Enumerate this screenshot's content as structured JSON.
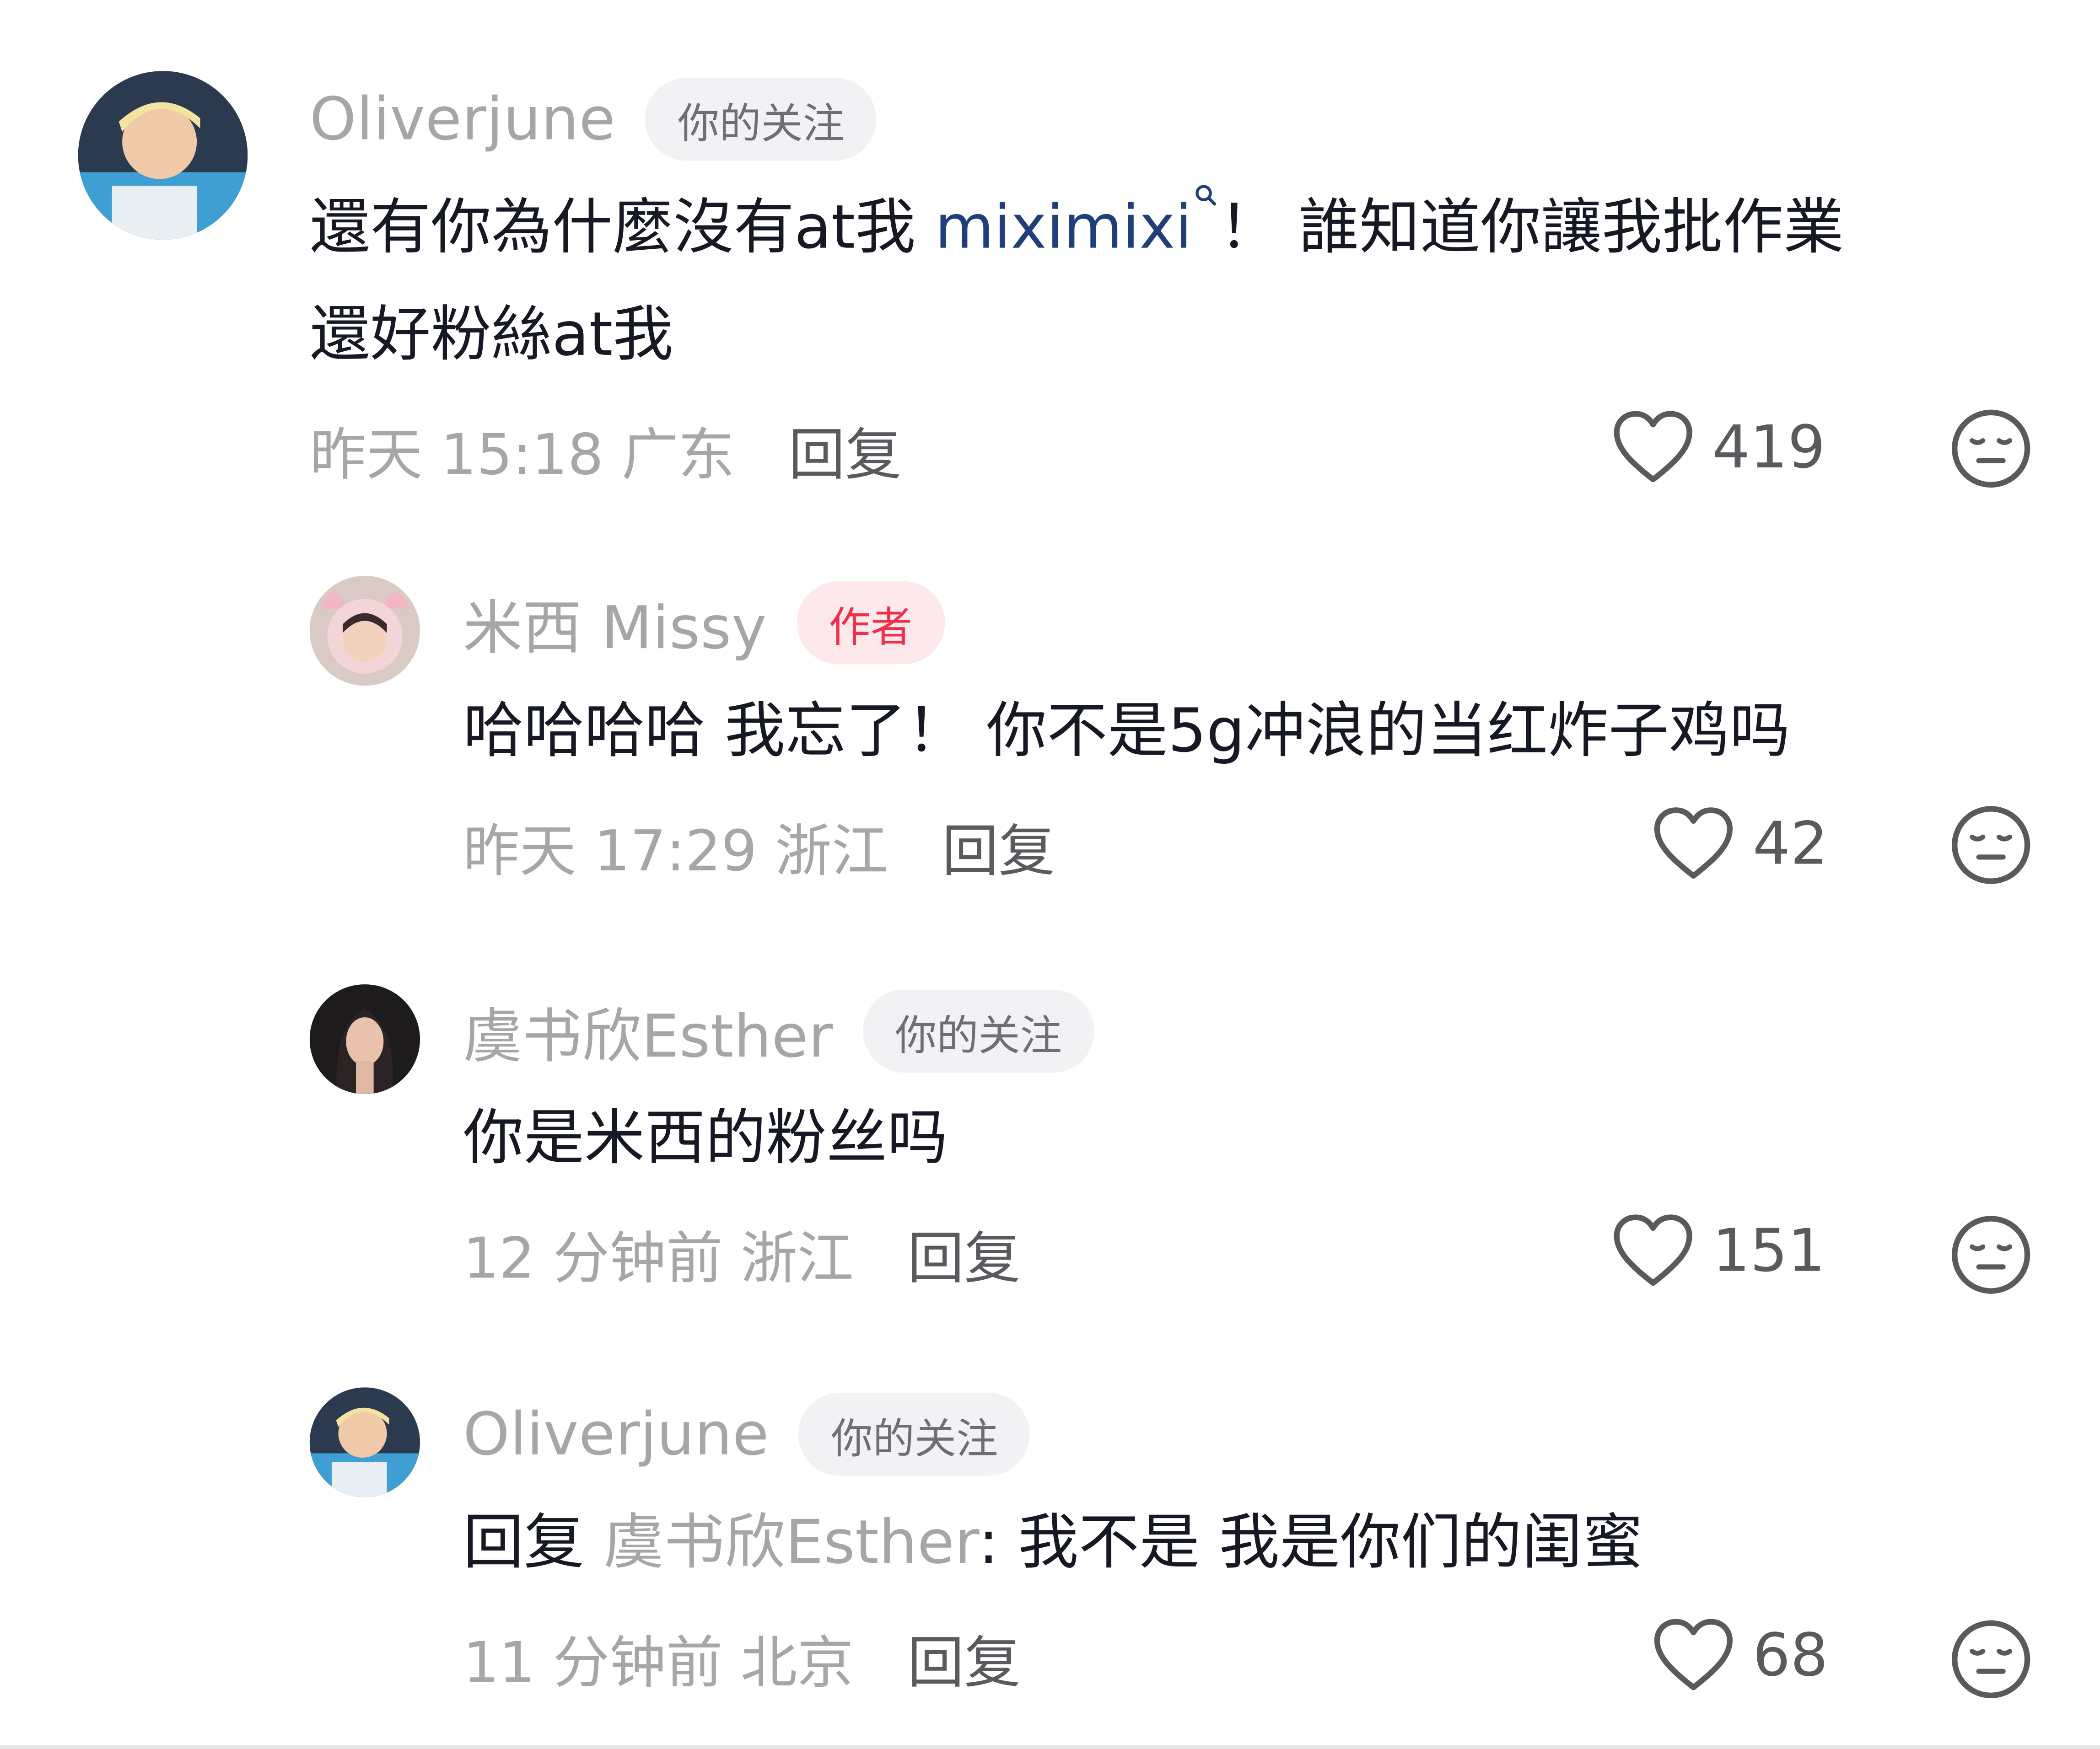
{
  "comments": [
    {
      "username": "Oliverjune",
      "badge": "你的关注",
      "text_line1_pre": "還有你為什麼沒有at我 ",
      "mention": "miximixi",
      "text_line1_post": "！ 誰知道你讓我批作業",
      "text_line2": "還好粉絲at我",
      "time": "昨天 15:18 广东",
      "reply": "回复",
      "likes": "419"
    },
    {
      "username": "米西 Missy",
      "badge": "作者",
      "text": "哈哈哈哈 我忘了！ 你不是5g冲浪的当红炸子鸡吗",
      "time": "昨天 17:29 浙江",
      "reply": "回复",
      "likes": "42"
    },
    {
      "username": "虞书欣Esther",
      "badge": "你的关注",
      "text": "你是米西的粉丝吗",
      "time": "12 分钟前 浙江",
      "reply": "回复",
      "likes": "151"
    },
    {
      "username": "Oliverjune",
      "badge": "你的关注",
      "reply_prefix": "回复 ",
      "reply_to": "虞书欣Esther",
      "text_after": ": 我不是 我是你们的闺蜜",
      "time": "11 分钟前 北京",
      "reply": "回复",
      "likes": "68"
    }
  ],
  "icons": {
    "like": "heart-outline-icon",
    "dislike": "neutral-face-icon",
    "mention": "search-icon"
  },
  "colors": {
    "username": "#a6a6a9",
    "text": "#161823",
    "mention": "#1f3f78",
    "author_badge": "#f0304a"
  }
}
